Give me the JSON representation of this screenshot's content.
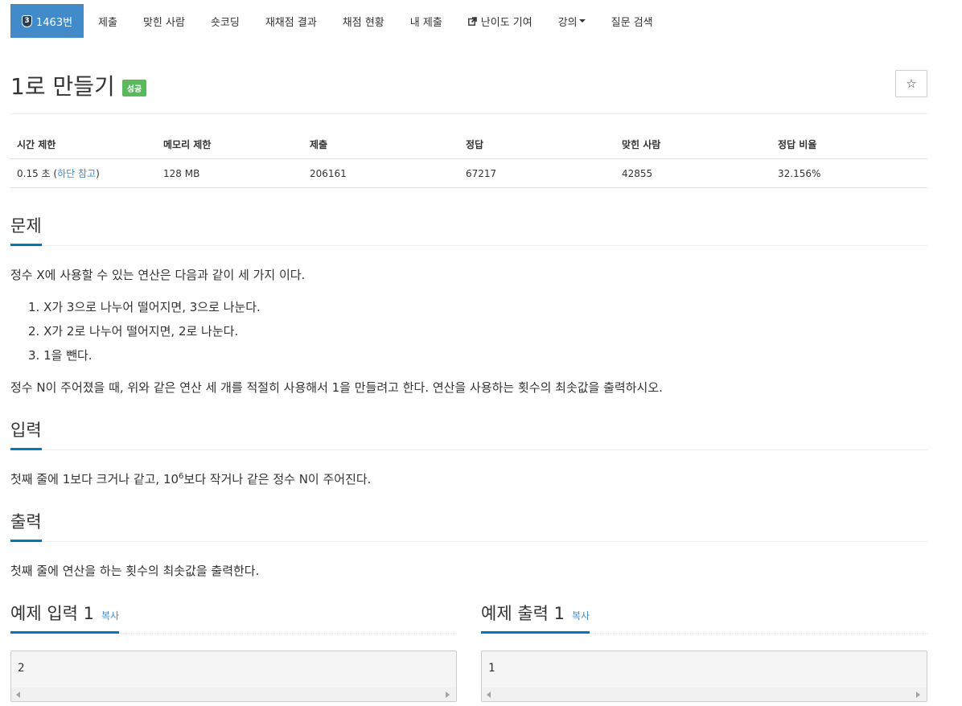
{
  "nav": {
    "active": {
      "badge": "3",
      "label": "1463번"
    },
    "items": [
      "제출",
      "맞힌 사람",
      "숏코딩",
      "재채점 결과",
      "채점 현황",
      "내 제출",
      "난이도 기여",
      "강의",
      "질문 검색"
    ]
  },
  "problem": {
    "title": "1로 만들기",
    "status_label": "성공",
    "star_icon": "☆"
  },
  "info": {
    "headers": [
      "시간 제한",
      "메모리 제한",
      "제출",
      "정답",
      "맞힌 사람",
      "정답 비율"
    ],
    "time_limit": "0.15 초",
    "time_note_open": "(",
    "time_note": "하단 참고",
    "time_note_close": ")",
    "memory": "128 MB",
    "submissions": "206161",
    "accepted": "67217",
    "solvers": "42855",
    "ratio": "32.156%"
  },
  "sections": {
    "description": {
      "heading": "문제",
      "intro": "정수 X에 사용할 수 있는 연산은 다음과 같이 세 가지 이다.",
      "ops": [
        "1. X가 3으로 나누어 떨어지면, 3으로 나눈다.",
        "2. X가 2로 나누어 떨어지면, 2로 나눈다.",
        "3. 1을 뺀다."
      ],
      "outro": "정수 N이 주어졌을 때, 위와 같은 연산 세 개를 적절히 사용해서 1을 만들려고 한다. 연산을 사용하는 횟수의 최솟값을 출력하시오."
    },
    "input": {
      "heading": "입력",
      "text_before": "첫째 줄에 1보다 크거나 같고, 10",
      "sup": "6",
      "text_after": "보다 작거나 같은 정수 N이 주어진다."
    },
    "output": {
      "heading": "출력",
      "text": "첫째 줄에 연산을 하는 횟수의 최솟값을 출력한다."
    },
    "sample_input": {
      "heading": "예제 입력 1",
      "copy": "복사",
      "value": "2"
    },
    "sample_output": {
      "heading": "예제 출력 1",
      "copy": "복사",
      "value": "1"
    }
  },
  "colors": {
    "accent": "#428bca",
    "success": "#5cb85c",
    "underline": "#0076c0"
  }
}
